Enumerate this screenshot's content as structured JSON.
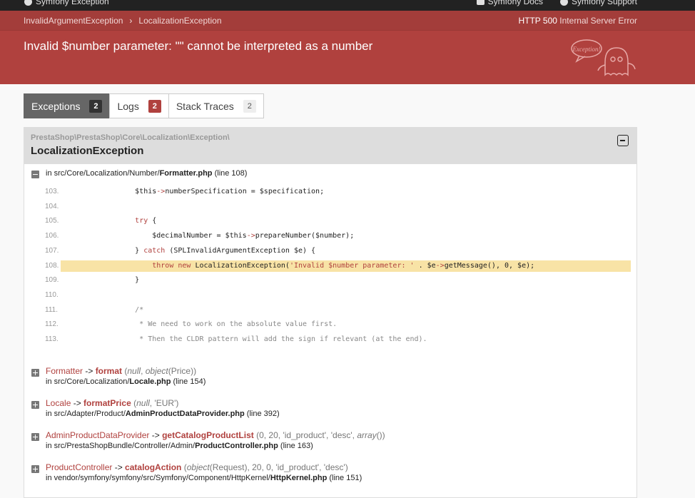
{
  "topbar": {
    "brand": "Symfony Exception",
    "docs": "Symfony Docs",
    "support": "Symfony Support"
  },
  "breadcrumb": {
    "first": "InvalidArgumentException",
    "second": "LocalizationException"
  },
  "status": {
    "code": "HTTP 500",
    "text": "Internal Server Error"
  },
  "error_title": "Invalid $number parameter: \"\" cannot be interpreted as a number",
  "mascot_text": "Exception!",
  "tabs": [
    {
      "label": "Exceptions",
      "count": "2"
    },
    {
      "label": "Logs",
      "count": "2"
    },
    {
      "label": "Stack Traces",
      "count": "2"
    }
  ],
  "exception": {
    "namespace": "PrestaShop\\PrestaShop\\Core\\Localization\\Exception\\",
    "class": "LocalizationException",
    "location": {
      "prefix": "in ",
      "path": "src/Core/Localization/Number/",
      "file": "Formatter.php",
      "line": " (line 108)"
    }
  },
  "code_lines": [
    {
      "num": "103.",
      "src": "        $this->numberSpecification = $specification;"
    },
    {
      "num": "104.",
      "src": ""
    },
    {
      "num": "105.",
      "src": "        try {"
    },
    {
      "num": "106.",
      "src": "            $decimalNumber = $this->prepareNumber($number);"
    },
    {
      "num": "107.",
      "src": "        } catch (SPLInvalidArgumentException $e) {"
    },
    {
      "num": "108.",
      "src": "            throw new LocalizationException('Invalid $number parameter: ' . $e->getMessage(), 0, $e);"
    },
    {
      "num": "109.",
      "src": "        }"
    },
    {
      "num": "110.",
      "src": ""
    },
    {
      "num": "111.",
      "src": "        /*"
    },
    {
      "num": "112.",
      "src": "         * We need to work on the absolute value first."
    },
    {
      "num": "113.",
      "src": "         * Then the CLDR pattern will add the sign if relevant (at the end)."
    }
  ],
  "frames": [
    {
      "class": "Formatter",
      "arrow": " -> ",
      "method": "format",
      "args_pre": " (",
      "args_i1": "null",
      "args_mid": ", ",
      "args_i2": "object",
      "args_post": "(Price))",
      "path_prefix": "in src/Core/Localization/",
      "file": "Locale.php",
      "line": " (line 154)"
    },
    {
      "class": "Locale",
      "arrow": " -> ",
      "method": "formatPrice",
      "args_pre": " (",
      "args_i1": "null",
      "args_mid": ", 'EUR')",
      "args_i2": "",
      "args_post": "",
      "path_prefix": "in src/Adapter/Product/",
      "file": "AdminProductDataProvider.php",
      "line": " (line 392)"
    },
    {
      "class": "AdminProductDataProvider",
      "arrow": " -> ",
      "method": "getCatalogProductList",
      "args_pre": " (0, 20, 'id_product', 'desc', ",
      "args_i1": "array",
      "args_mid": "())",
      "args_i2": "",
      "args_post": "",
      "path_prefix": "in src/PrestaShopBundle/Controller/Admin/",
      "file": "ProductController.php",
      "line": " (line 163)"
    },
    {
      "class": "ProductController",
      "arrow": " -> ",
      "method": "catalogAction",
      "args_pre": " (",
      "args_i1": "object",
      "args_mid": "(Request), 20, 0, 'id_product', 'desc')",
      "args_i2": "",
      "args_post": "",
      "path_prefix": "in vendor/symfony/symfony/src/Symfony/Component/HttpKernel/",
      "file": "HttpKernel.php",
      "line": " (line 151)"
    }
  ],
  "colors": {
    "header": "#b0413e",
    "highlight": "#f8e3a6",
    "accent": "#b0413e"
  }
}
